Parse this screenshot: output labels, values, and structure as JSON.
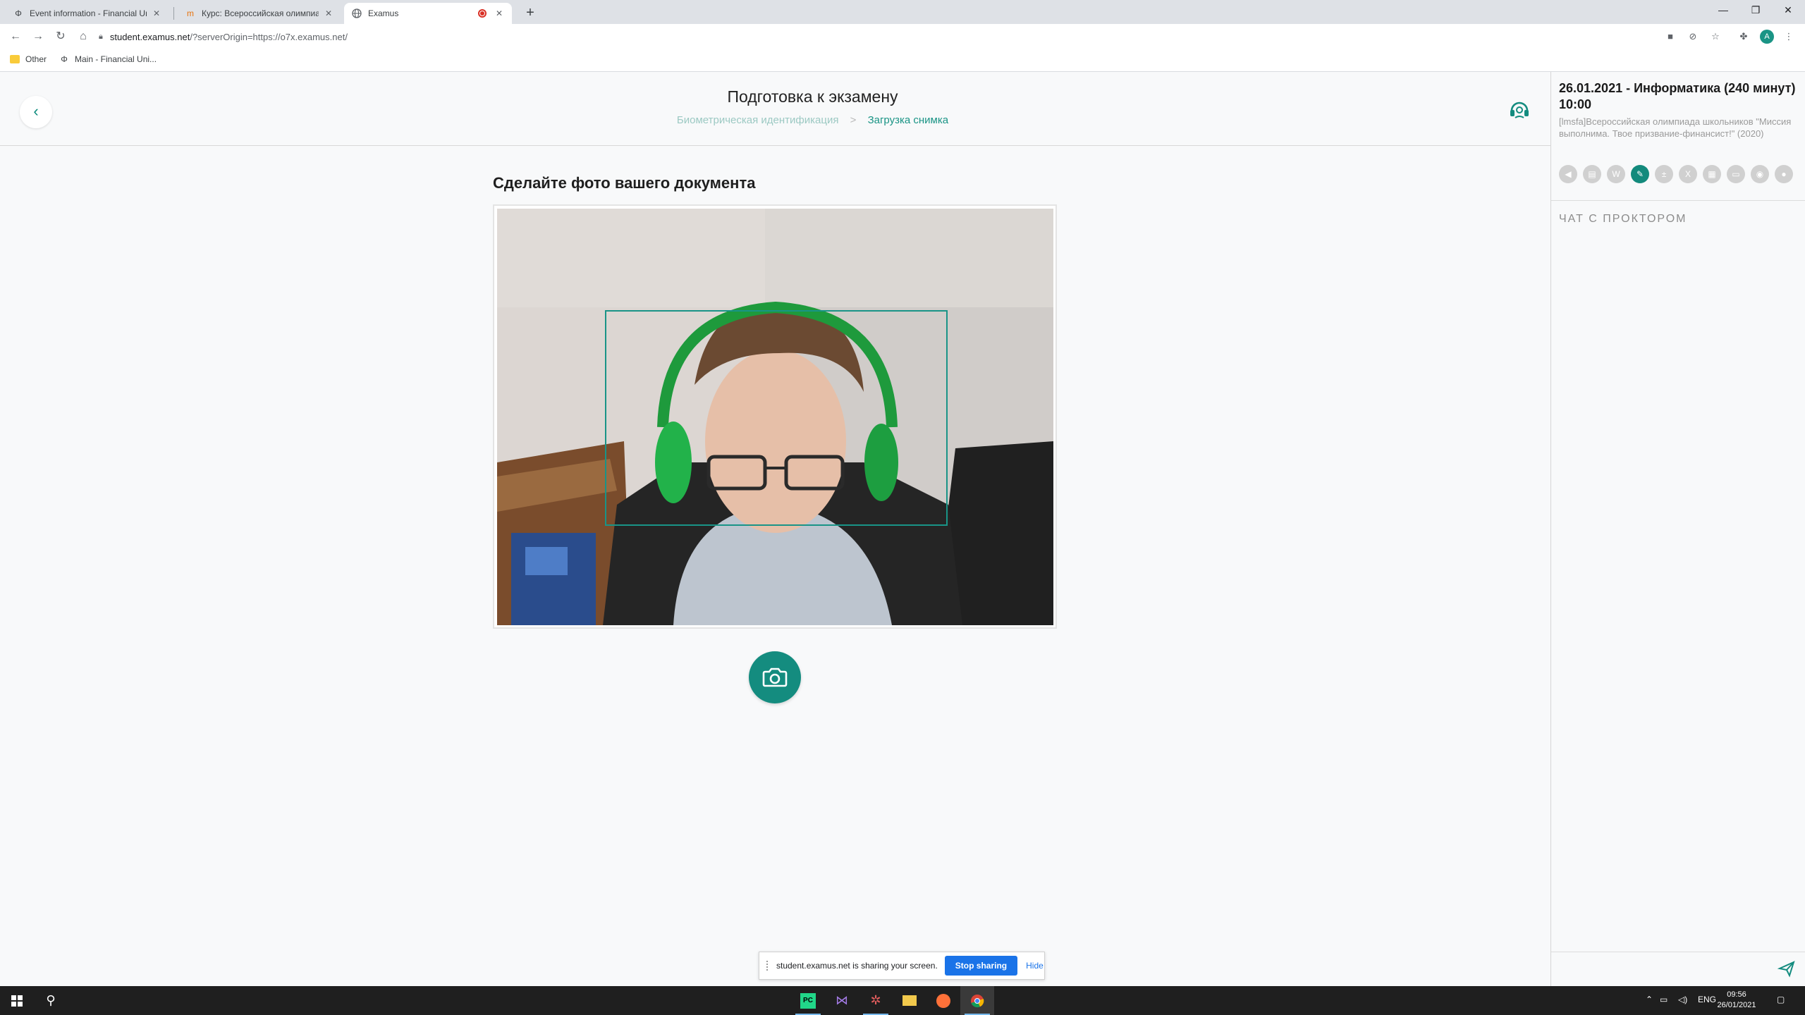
{
  "browser": {
    "tabs": [
      {
        "title": "Event information - Financial Uni",
        "close": "✕"
      },
      {
        "title": "Курс: Всероссийская олимпиада",
        "close": "✕"
      },
      {
        "title": "Examus",
        "close": "✕"
      }
    ],
    "new_tab": "+",
    "window_controls": {
      "minimize": "—",
      "restore": "❐",
      "close": "✕"
    },
    "url_host": "student.examus.net",
    "url_path": "/?serverOrigin=https://o7x.examus.net/",
    "bookmarks": [
      {
        "label": "Other"
      },
      {
        "label": "Main - Financial Uni..."
      }
    ]
  },
  "page": {
    "title": "Подготовка к экзамену",
    "breadcrumb": {
      "step1": "Биометрическая идентификация",
      "separator": ">",
      "step2": "Загрузка снимка"
    },
    "doc_heading": "Сделайте фото вашего документа"
  },
  "sidebar": {
    "exam_title": "26.01.2021 - Информатика (240 минут) 10:00",
    "course": "[lmsfa]Всероссийская олимпиада школьников \"Миссия выполнима. Твое призвание-финансист!\" (2020)",
    "tools": [
      {
        "icon": "megaphone-icon",
        "active": false
      },
      {
        "icon": "book-icon",
        "active": false
      },
      {
        "icon": "word-doc-icon",
        "active": false
      },
      {
        "icon": "notepad-icon",
        "active": true
      },
      {
        "icon": "calculator-icon",
        "active": false
      },
      {
        "icon": "excel-icon",
        "active": false
      },
      {
        "icon": "table-icon",
        "active": false
      },
      {
        "icon": "image-icon",
        "active": false
      },
      {
        "icon": "eye-icon",
        "active": false
      },
      {
        "icon": "user-icon",
        "active": false
      }
    ],
    "chat_title": "ЧАТ С ПРОКТОРОМ"
  },
  "sharing_bar": {
    "text": "student.examus.net is sharing your screen.",
    "stop": "Stop sharing",
    "hide": "Hide"
  },
  "taskbar": {
    "lang": "ENG",
    "time": "09:56",
    "date": "26/01/2021"
  },
  "colors": {
    "accent": "#148c7f",
    "breadcrumb_inactive": "#9cc9c3",
    "stop_button": "#1a73e8"
  }
}
